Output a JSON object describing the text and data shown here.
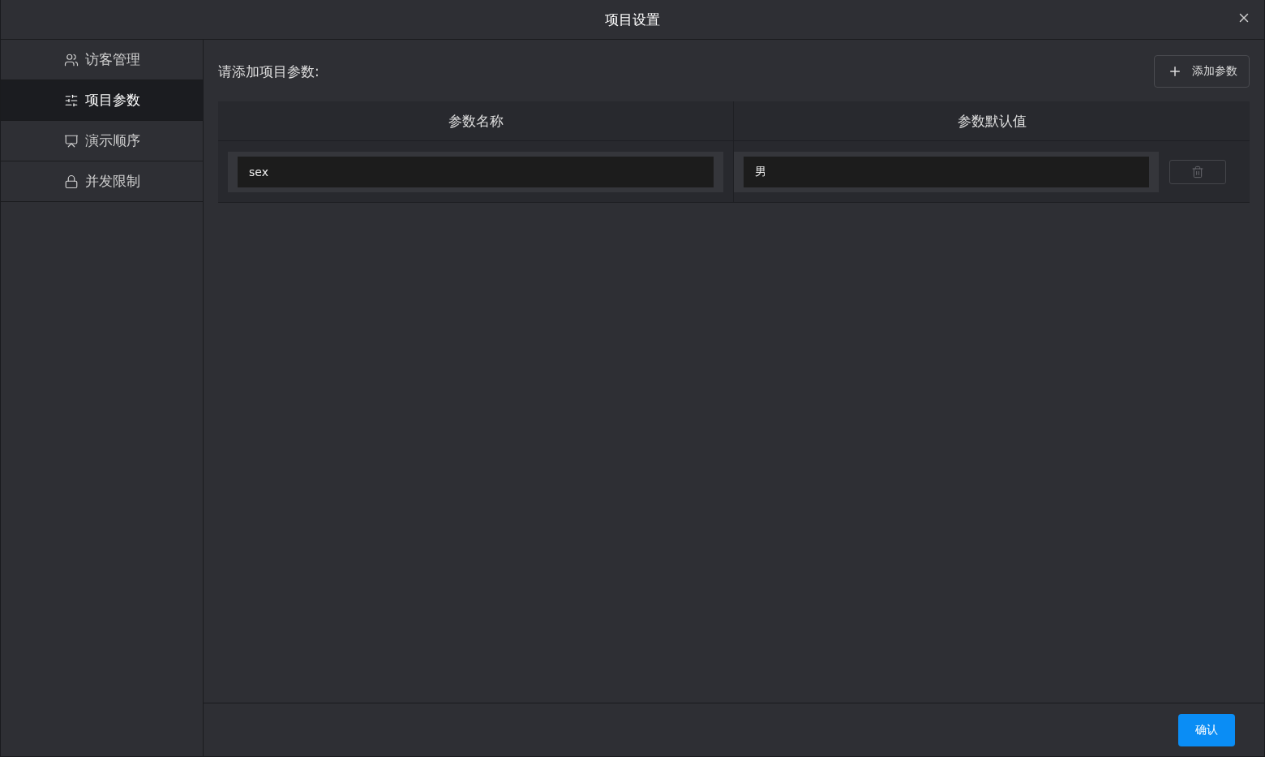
{
  "window": {
    "title": "项目设置"
  },
  "sidebar": {
    "items": [
      {
        "label": "访客管理",
        "selected": false
      },
      {
        "label": "项目参数",
        "selected": true
      },
      {
        "label": "演示顺序",
        "selected": false
      },
      {
        "label": "并发限制",
        "selected": false
      }
    ]
  },
  "content": {
    "heading": "请添加项目参数:",
    "add_button": "添加参数"
  },
  "table": {
    "columns": [
      "参数名称",
      "参数默认值"
    ],
    "rows": [
      {
        "name": "sex",
        "value": "男",
        "delete_disabled": true
      }
    ]
  },
  "footer": {
    "confirm_button": "确认"
  }
}
